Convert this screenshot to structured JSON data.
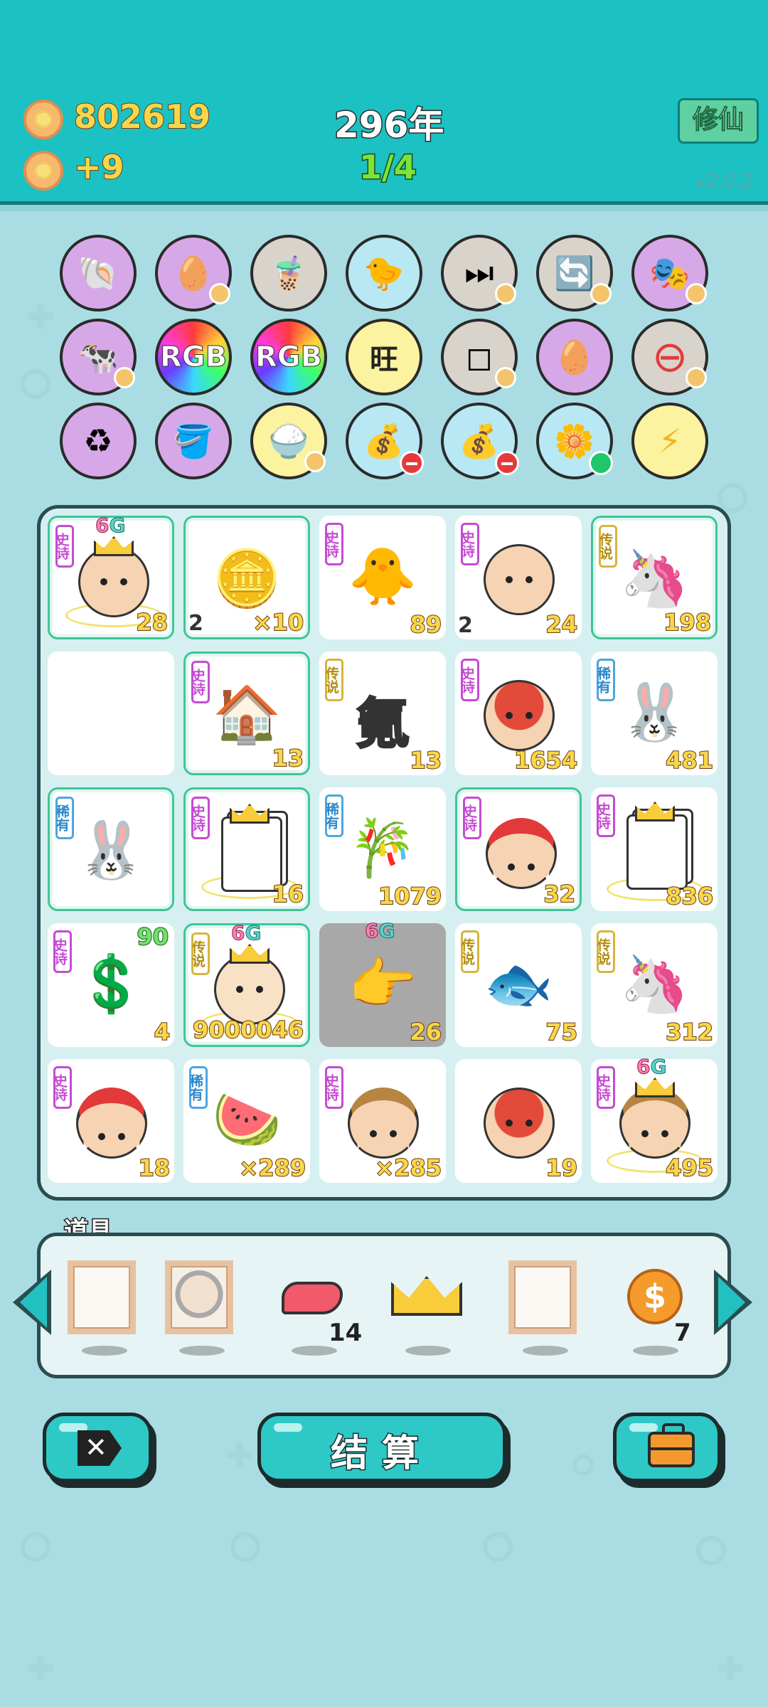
{
  "header": {
    "coins": "802619",
    "coin_rate": "+9",
    "year": "296年",
    "progress": "1/4",
    "cultivate_button": "修仙",
    "version": "v2.0.2"
  },
  "skills": [
    {
      "name": "shell-icon",
      "glyph": "🐚",
      "bg": "#d7a8e8"
    },
    {
      "name": "egg-icon",
      "glyph": "🥚",
      "bg": "#d7a8e8"
    },
    {
      "name": "milk-tea-icon",
      "glyph": "🧋",
      "bg": "#d8d4cc"
    },
    {
      "name": "duck-pot-icon",
      "glyph": "🐤",
      "bg": "#b8e8f4"
    },
    {
      "name": "skip-icon",
      "glyph": "⏭",
      "bg": "#d8d4cc"
    },
    {
      "name": "refresh-icon",
      "glyph": "🔄",
      "bg": "#d8d4cc"
    },
    {
      "name": "mask-icon",
      "glyph": "🎭",
      "bg": "#d7a8e8"
    },
    {
      "name": "cows-icon",
      "glyph": "🐄",
      "bg": "#d7a8e8"
    },
    {
      "name": "rgb-icon",
      "glyph": "RGB",
      "bg": "#6a3bd8"
    },
    {
      "name": "rgb-icon",
      "glyph": "RGB",
      "bg": "#6a3bd8"
    },
    {
      "name": "wang-icon",
      "glyph": "旺",
      "bg": "#fbf3a0"
    },
    {
      "name": "dice-icon",
      "glyph": "◻",
      "bg": "#d8d4cc"
    },
    {
      "name": "egg-icon",
      "glyph": "🥚",
      "bg": "#d7a8e8"
    },
    {
      "name": "minus-icon",
      "glyph": "⊖",
      "bg": "#d8d4cc"
    },
    {
      "name": "recycle-icon",
      "glyph": "♻",
      "bg": "#d7a8e8"
    },
    {
      "name": "bucket-icon",
      "glyph": "🪣",
      "bg": "#d7a8e8"
    },
    {
      "name": "rice-icon",
      "glyph": "🍚",
      "bg": "#fbf3a0"
    },
    {
      "name": "bag-icon",
      "glyph": "💰",
      "bg": "#b8e8f4"
    },
    {
      "name": "bag-icon",
      "glyph": "💰",
      "bg": "#b8e8f4"
    },
    {
      "name": "flower-icon",
      "glyph": "🌼",
      "bg": "#b8e8f4"
    },
    {
      "name": "lightning-icon",
      "glyph": "⚡",
      "bg": "#fbf3a0"
    }
  ],
  "board": [
    {
      "rarity": "史诗",
      "type": "epic",
      "value": "28",
      "left": "",
      "top": "",
      "six_g": true,
      "content": "old-man",
      "glow": true
    },
    {
      "rarity": "",
      "type": "",
      "value": "×10",
      "left": "2",
      "top": "",
      "six_g": false,
      "content": "gold-bars",
      "glow": true
    },
    {
      "rarity": "史诗",
      "type": "epic",
      "value": "89",
      "left": "",
      "top": "",
      "six_g": false,
      "content": "bird",
      "glow": false
    },
    {
      "rarity": "史诗",
      "type": "epic",
      "value": "24",
      "left": "2",
      "top": "",
      "six_g": false,
      "content": "grandpa",
      "glow": false
    },
    {
      "rarity": "传说",
      "type": "leg",
      "value": "198",
      "left": "",
      "top": "",
      "six_g": false,
      "content": "unicorn",
      "glow": true
    },
    {
      "rarity": "",
      "type": "",
      "value": "",
      "left": "",
      "top": "",
      "six_g": false,
      "content": "empty",
      "glow": false
    },
    {
      "rarity": "史诗",
      "type": "epic",
      "value": "13",
      "left": "",
      "top": "",
      "six_g": false,
      "content": "rabbit-house",
      "glow": true
    },
    {
      "rarity": "传说",
      "type": "leg",
      "value": "13",
      "left": "",
      "top": "",
      "six_g": false,
      "content": "氪",
      "glow": false
    },
    {
      "rarity": "史诗",
      "type": "epic",
      "value": "1654",
      "left": "",
      "top": "",
      "six_g": false,
      "content": "basketball-man",
      "glow": false
    },
    {
      "rarity": "稀有",
      "type": "rare",
      "value": "481",
      "left": "",
      "top": "",
      "six_g": false,
      "content": "rabbit",
      "glow": false
    },
    {
      "rarity": "稀有",
      "type": "rare",
      "value": "",
      "left": "",
      "top": "",
      "six_g": false,
      "content": "rabbit",
      "glow": true
    },
    {
      "rarity": "史诗",
      "type": "epic",
      "value": "16",
      "left": "",
      "top": "",
      "six_g": false,
      "content": "ctrl-v",
      "glow": true
    },
    {
      "rarity": "稀有",
      "type": "rare",
      "value": "1079",
      "left": "",
      "top": "",
      "six_g": false,
      "content": "bamboo",
      "glow": false
    },
    {
      "rarity": "史诗",
      "type": "epic",
      "value": "32",
      "left": "",
      "top": "",
      "six_g": false,
      "content": "red-hat-boy",
      "glow": true
    },
    {
      "rarity": "史诗",
      "type": "epic",
      "value": "836",
      "left": "",
      "top": "",
      "six_g": false,
      "content": "ctrl-c",
      "glow": false
    },
    {
      "rarity": "史诗",
      "type": "epic",
      "value": "4",
      "left": "",
      "top": "90",
      "six_g": false,
      "content": "coin-arrow",
      "glow": false
    },
    {
      "rarity": "传说",
      "type": "leg",
      "value": "9000046",
      "left": "",
      "top": "",
      "six_g": true,
      "content": "king",
      "glow": true
    },
    {
      "rarity": "",
      "type": "",
      "value": "26",
      "left": "",
      "top": "",
      "six_g": true,
      "content": "finger",
      "glow": false,
      "grey": true
    },
    {
      "rarity": "传说",
      "type": "leg",
      "value": "75",
      "left": "",
      "top": "",
      "six_g": false,
      "content": "koi",
      "glow": false
    },
    {
      "rarity": "传说",
      "type": "leg",
      "value": "312",
      "left": "",
      "top": "",
      "six_g": false,
      "content": "unicorn",
      "glow": false
    },
    {
      "rarity": "史诗",
      "type": "epic",
      "value": "18",
      "left": "",
      "top": "",
      "six_g": false,
      "content": "red-hat-boy",
      "glow": false
    },
    {
      "rarity": "稀有",
      "type": "rare",
      "value": "×289",
      "left": "",
      "top": "",
      "six_g": false,
      "content": "watermelon",
      "glow": false
    },
    {
      "rarity": "史诗",
      "type": "epic",
      "value": "×285",
      "left": "",
      "top": "",
      "six_g": false,
      "content": "farmer",
      "glow": false
    },
    {
      "rarity": "",
      "type": "",
      "value": "19",
      "left": "",
      "top": "",
      "six_g": false,
      "content": "basketball-old",
      "glow": false
    },
    {
      "rarity": "史诗",
      "type": "epic",
      "value": "495",
      "left": "",
      "top": "",
      "six_g": true,
      "content": "farmer-king",
      "glow": false
    }
  ],
  "tools": {
    "label": "道具",
    "items": [
      {
        "name": "empty-frame",
        "count": ""
      },
      {
        "name": "portrait-frame",
        "count": ""
      },
      {
        "name": "liver",
        "count": "14"
      },
      {
        "name": "crown",
        "count": ""
      },
      {
        "name": "empty-frame",
        "count": ""
      },
      {
        "name": "dollar-coin",
        "count": "7"
      }
    ]
  },
  "buttons": {
    "close": "✕",
    "settle": "结算"
  },
  "colors": {
    "header": "#1cc1c3",
    "background": "#a9dde3",
    "accent": "#2ec8c7"
  }
}
